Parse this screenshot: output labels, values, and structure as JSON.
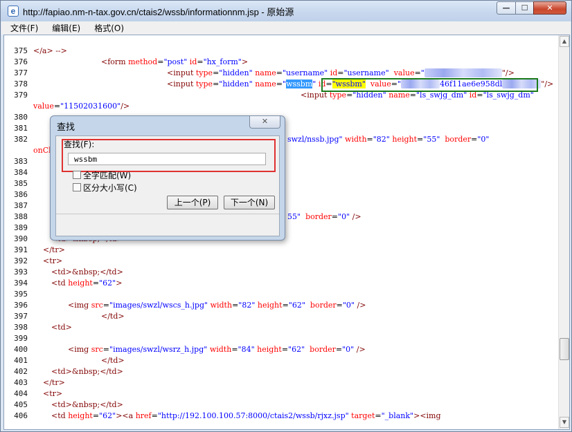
{
  "window": {
    "title": "http://fapiao.nm-n-tax.gov.cn/ctais2/wssb/informationnm.jsp - 原始源",
    "app_icon": "e",
    "minimize_glyph": "—",
    "maximize_glyph": "☐",
    "close_glyph": "✕"
  },
  "menu": {
    "items": [
      {
        "label": "文件(F)"
      },
      {
        "label": "编辑(E)"
      },
      {
        "label": "格式(O)"
      }
    ]
  },
  "source": {
    "line_numbers": [
      "375",
      "376",
      "377",
      "378",
      "379",
      "380",
      "381",
      "382",
      "383",
      "384",
      "385",
      "386",
      "387",
      "388",
      "389",
      "390",
      "391",
      "392",
      "393",
      "394",
      "395",
      "396",
      "397",
      "398",
      "399",
      "400",
      "401",
      "402",
      "403",
      "404",
      "405",
      "406"
    ],
    "code": {
      "l375": "</a> -->",
      "l376_tag": "<form",
      "l376_a1": "method",
      "l376_v1": "\"post\"",
      "l376_a2": "id",
      "l376_v2": "\"hx_form\"",
      "l376_end": ">",
      "l377_tag": "<input",
      "l377_rest_a": "type",
      "l377_rest_v": "\"hidden\"",
      "l377_a2": "name",
      "l377_v2": "\"username\"",
      "l377_a3": "id",
      "l377_v3": "\"username\"",
      "l377_a4": "value",
      "l377_v4": "\"",
      "l377_blur": "0000000000000000",
      "l377_end": "\"/>",
      "l378_tag": "<input",
      "l378_a1": "type",
      "l378_v1": "\"hidden\"",
      "l378_a2": "name",
      "l378_q1": "\"",
      "l378_sel": "wssbm",
      "l378_q2": "\"",
      "l378_a3": "id",
      "l378_eq": "=",
      "l378_yel": "\"wssbm\"",
      "l378_a4": "value",
      "l378_v4": "\"",
      "l378_blur1": "00000000",
      "l378_hex": "46f11ae6e958dl",
      "l378_blur2": "00000000",
      "l378_end": "\"/>",
      "l379_tag": "<input",
      "l379_a1": "type",
      "l379_v1": "\"hidden\"",
      "l379_a2": "name",
      "l379_v2": "\"ls_swjg_dm\"",
      "l379_a3": "id",
      "l379_v3": "\"ls_swjg_dm\"",
      "l379b_a": "value",
      "l379b_v": "\"11502031600\"",
      "l379b_end": "/>",
      "l382_tail": "swzl/nssb.jpg\"",
      "l382_a1": "width",
      "l382_v1": "\"82\"",
      "l382_a2": "height",
      "l382_v2": "\"55\"",
      "l382_a3": "border",
      "l382_v3": "\"0\"",
      "l382b": "onCl",
      "l388_v": "55\"",
      "l388_a": "border",
      "l388_v2": "\"0\"",
      "l388_end": "/>",
      "l390": "<td>&nbsp;</td>",
      "l391": "</tr>",
      "l392": "<tr>",
      "l393": "<td>&nbsp;</td>",
      "l394_tag": "<td",
      "l394_a": "height",
      "l394_v": "\"62\"",
      "l394_end": ">",
      "l396_tag": "<img",
      "l396_a1": "src",
      "l396_v1": "\"images/swzl/wscs_h.jpg\"",
      "l396_a2": "width",
      "l396_v2": "\"82\"",
      "l396_a3": "height",
      "l396_v3": "\"62\"",
      "l396_a4": "border",
      "l396_v4": "\"0\"",
      "l396_end": "/>",
      "l397": "</td>",
      "l398": "<td>",
      "l400_tag": "<img",
      "l400_a1": "src",
      "l400_v1": "\"images/swzl/wsrz_h.jpg\"",
      "l400_a2": "width",
      "l400_v2": "\"84\"",
      "l400_a3": "height",
      "l400_v3": "\"62\"",
      "l400_a4": "border",
      "l400_v4": "\"0\"",
      "l400_end": "/>",
      "l401": "</td>",
      "l402": "<td>&nbsp;</td>",
      "l403": "</tr>",
      "l404": "<tr>",
      "l405": "<td>&nbsp;</td>",
      "l406_tag": "<td",
      "l406_a1": "height",
      "l406_v1": "\"62\"",
      "l406_tag2": "><a",
      "l406_a2": "href",
      "l406_v2": "\"http://192.100.100.57:8000/ctais2/wssb/rjxz.jsp\"",
      "l406_a3": "target",
      "l406_v3": "\"_blank\"",
      "l406_end": "><img"
    }
  },
  "find_dialog": {
    "title": "查找",
    "close_glyph": "✕",
    "find_label": "查找(F):",
    "search_value": "wssbm",
    "whole_word_label": "全字匹配(W)",
    "match_case_label": "区分大小写(C)",
    "prev_button": "上一个(P)",
    "next_button": "下一个(N)"
  },
  "scrollbar": {
    "up_glyph": "▲",
    "down_glyph": "▼"
  },
  "colors": {
    "tag": "#800000",
    "attribute": "#ff0000",
    "value": "#0000ff",
    "selection": "#3399ff",
    "highlight": "#ffff00",
    "annotation_green": "#1a7a1a",
    "annotation_red": "#e03030"
  }
}
